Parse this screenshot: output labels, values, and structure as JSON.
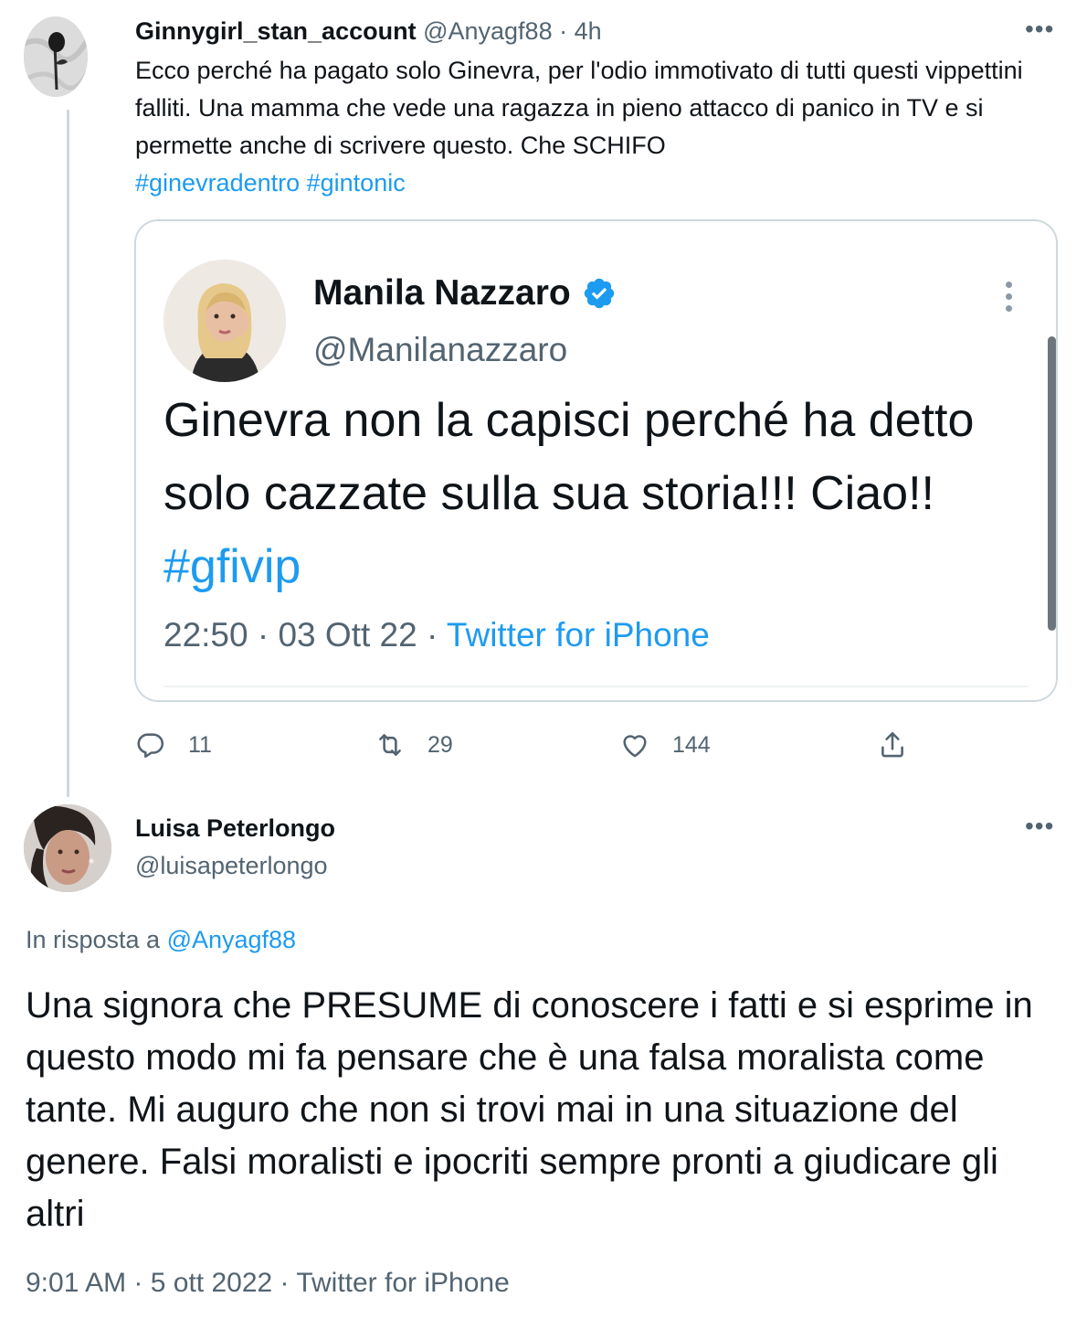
{
  "thread_tweet": {
    "display_name": "Ginnygirl_stan_account",
    "handle": "@Anyagf88",
    "separator": " · ",
    "time_ago": "4h",
    "more_label": "•••",
    "text": "Ecco perché ha pagato solo Ginevra, per l'odio immotivato di tutti questi vippettini falliti. Una mamma che vede una ragazza in pieno attacco di panico in TV e si permette anche di scrivere questo. Che SCHIFO",
    "hashtags": "#ginevradentro #gintonic",
    "avatar_icon": "rose-avatar-icon"
  },
  "quoted_tweet": {
    "display_name": "Manila Nazzaro",
    "verified_icon": "verified-badge-icon",
    "handle": "@Manilanazzaro",
    "text": "Ginevra non la capisci perché ha detto solo cazzate sulla sua storia!!! Ciao!! ",
    "hashtag": "#gfivip",
    "time": "22:50",
    "sep1": " · ",
    "date": "03 Ott 22",
    "sep2": " · ",
    "source": "Twitter for iPhone"
  },
  "actions": {
    "reply_count": "11",
    "retweet_count": "29",
    "like_count": "144"
  },
  "reply_tweet": {
    "display_name": "Luisa Peterlongo",
    "handle": "@luisapeterlongo",
    "more_label": "•••",
    "reply_prefix": "In risposta a ",
    "reply_handle": "@Anyagf88",
    "text": "Una signora che PRESUME di conoscere i fatti e si esprime in questo modo mi fa pensare che è una falsa moralista come tante. Mi auguro che non si trovi mai in una situazione del genere. Falsi moralisti e ipocriti sempre pronti a giudicare gli altri",
    "time": "9:01 AM",
    "sep1": " · ",
    "date": "5 ott 2022",
    "sep2": " · ",
    "source": "Twitter for iPhone"
  },
  "colors": {
    "link": "#1d9bf0",
    "muted": "#536471",
    "text": "#0f1419",
    "border": "#cfd9de"
  }
}
